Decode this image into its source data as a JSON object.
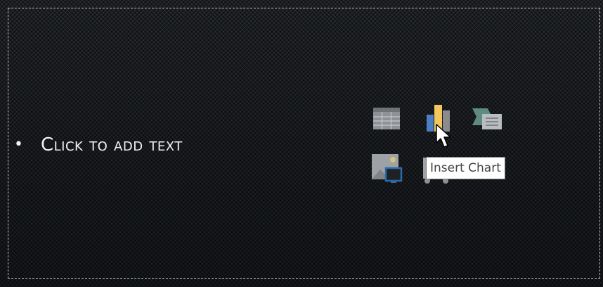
{
  "slide": {
    "bullet": "•",
    "placeholder_text": "Click to add text"
  },
  "content_icons": [
    {
      "name": "table-icon",
      "label": ""
    },
    {
      "name": "chart-icon",
      "label": ""
    },
    {
      "name": "smartart-icon",
      "label": ""
    },
    {
      "name": "picture-icon",
      "label": ""
    },
    {
      "name": "video-icon",
      "label": ""
    }
  ],
  "tooltip": {
    "text": "Insert Chart"
  },
  "colors": {
    "background": "#1e2125",
    "placeholder_border": "#bfbfbf",
    "text": "#f2f2f2",
    "chart_blue": "#4a7fc1",
    "chart_yellow": "#f2c75c",
    "chart_gray": "#8c8c8c",
    "icon_gray": "#8e9196",
    "smartart_green": "#5f8a80",
    "picture_blue": "#2b6aa8"
  }
}
